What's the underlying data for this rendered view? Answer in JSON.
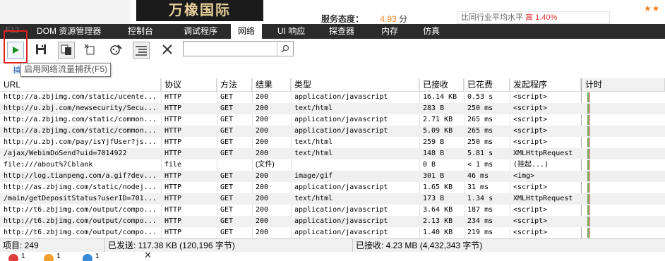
{
  "webpage": {
    "logo_text": "万橡国际",
    "service_label": "服务态度：",
    "service_score": "4.93",
    "service_unit": "分",
    "compare_text": "比同行业平均水平",
    "compare_value": "高 1.40%"
  },
  "devtools": {
    "f12_label": "F12",
    "tabs": [
      {
        "label": "DOM 资源管理器"
      },
      {
        "label": "控制台"
      },
      {
        "label": "调试程序"
      },
      {
        "label": "网络"
      },
      {
        "label": "UI 响应"
      },
      {
        "label": "探查器"
      },
      {
        "label": "内存"
      },
      {
        "label": "仿真"
      }
    ],
    "active_tab": "网络",
    "toolbar": {
      "tooltip": "启用网络流量捕获(F5)",
      "capture_hint": "捕",
      "search_value": ""
    },
    "grid": {
      "headers": [
        "URL",
        "协议",
        "方法",
        "结果",
        "类型",
        "已接收",
        "已花费",
        "发起程序",
        "计时"
      ],
      "rows": [
        [
          "http://a.zbjimg.com/static/ucente...",
          "HTTP",
          "GET",
          "200",
          "application/javascript",
          "16.14 KB",
          "0.53 s",
          "<script>"
        ],
        [
          "http://u.zbj.com/newsecurity/Secu...",
          "HTTP",
          "GET",
          "200",
          "text/html",
          "283 B",
          "250 ms",
          "<script>"
        ],
        [
          "http://a.zbjimg.com/static/common...",
          "HTTP",
          "GET",
          "200",
          "application/javascript",
          "2.71 KB",
          "265 ms",
          "<script>"
        ],
        [
          "http://a.zbjimg.com/static/common...",
          "HTTP",
          "GET",
          "200",
          "application/javascript",
          "5.09 KB",
          "265 ms",
          "<script>"
        ],
        [
          "http://u.zbj.com/pay/isYjfUser?js...",
          "HTTP",
          "GET",
          "200",
          "text/html",
          "259 B",
          "250 ms",
          "<script>"
        ],
        [
          "/ajax/WebimDoSend?uid=7014922",
          "HTTP",
          "GET",
          "200",
          "text/html",
          "148 B",
          "5.81 s",
          "XMLHttpRequest"
        ],
        [
          "file:///about%7Cblank",
          "file",
          "",
          "(文件)",
          "",
          "0 B",
          "< 1 ms",
          "(挂起...)"
        ],
        [
          "http://log.tianpeng.com/a.gif?dev...",
          "HTTP",
          "GET",
          "200",
          "image/gif",
          "301 B",
          "46 ms",
          "<img>"
        ],
        [
          "http://as.zbjimg.com/static/nodej...",
          "HTTP",
          "GET",
          "200",
          "application/javascript",
          "1.65 KB",
          "31 ms",
          "<script>"
        ],
        [
          "/main/getDepositStatus?userID=701...",
          "HTTP",
          "GET",
          "200",
          "text/html",
          "173 B",
          "1.34 s",
          "XMLHttpRequest"
        ],
        [
          "http://t6.zbjimg.com/output/compo...",
          "HTTP",
          "GET",
          "200",
          "application/javascript",
          "3.64 KB",
          "187 ms",
          "<script>"
        ],
        [
          "http://t6.zbjimg.com/output/compo...",
          "HTTP",
          "GET",
          "200",
          "application/javascript",
          "2.13 KB",
          "234 ms",
          "<script>"
        ],
        [
          "http://t6.zbjimg.com/output/compo...",
          "HTTP",
          "GET",
          "200",
          "application/javascript",
          "1.40 KB",
          "219 ms",
          "<script>"
        ]
      ]
    },
    "status": {
      "items": "项目: 249",
      "sent": "已发送: 117.38 KB (120,196 字节)",
      "received": "已接收: 4.23 MB (4,432,343 字节)"
    },
    "bottom": {
      "errors": "1",
      "warnings": "1",
      "info": "1"
    }
  },
  "colors": {
    "tabbar_bg": "#2b2b2b",
    "highlight_box": "#e02020",
    "play_green": "#1a8d1a"
  }
}
